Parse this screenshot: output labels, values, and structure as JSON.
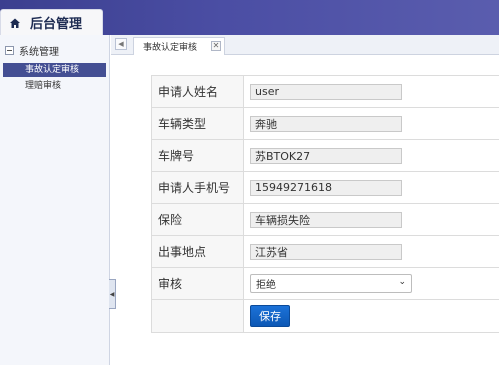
{
  "header": {
    "title": "后台管理"
  },
  "sidebar": {
    "group": "系统管理",
    "items": [
      {
        "label": "事故认定审核",
        "active": true
      },
      {
        "label": "理赔审核",
        "active": false
      }
    ]
  },
  "tabs": {
    "active_tab": "事故认定审核"
  },
  "form": {
    "rows": [
      {
        "label": "申请人姓名",
        "value": "user"
      },
      {
        "label": "车辆类型",
        "value": "奔驰"
      },
      {
        "label": "车牌号",
        "value": "苏BTOK27"
      },
      {
        "label": "申请人手机号",
        "value": "15949271618"
      },
      {
        "label": "保险",
        "value": "车辆损失险"
      },
      {
        "label": "出事地点",
        "value": "江苏省"
      }
    ],
    "review": {
      "label": "审核",
      "selected": "拒绝"
    },
    "save_label": "保存"
  },
  "colors": {
    "header": "#3f4394",
    "active_item": "#444f93",
    "button": "#1366c6"
  }
}
